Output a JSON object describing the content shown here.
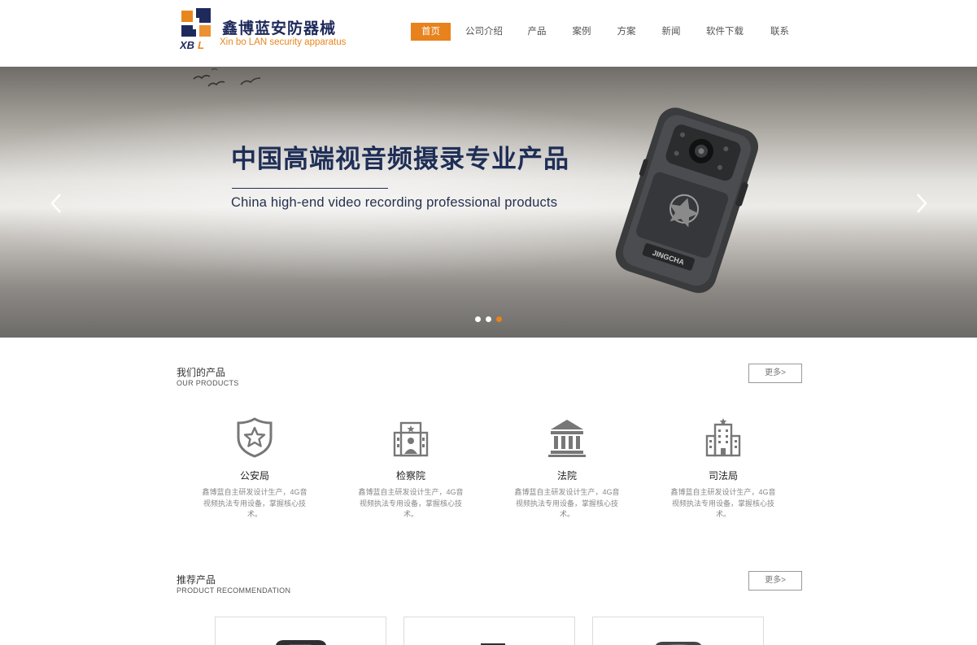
{
  "brand": {
    "name_cn": "鑫博蓝安防器械",
    "name_en": "Xin bo LAN security apparatus",
    "mark": "XBL"
  },
  "nav": {
    "items": [
      {
        "label": "首页",
        "active": true
      },
      {
        "label": "公司介绍",
        "active": false
      },
      {
        "label": "产品",
        "active": false
      },
      {
        "label": "案例",
        "active": false
      },
      {
        "label": "方案",
        "active": false
      },
      {
        "label": "新闻",
        "active": false
      },
      {
        "label": "软件下载",
        "active": false
      },
      {
        "label": "联系",
        "active": false
      }
    ]
  },
  "banner": {
    "title": "中国高端视音频摄录专业产品",
    "subtitle": "China high-end video recording professional products",
    "camera_label": "JINGCHA",
    "prev_icon": "chevron-left-icon",
    "next_icon": "chevron-right-icon",
    "slides_total": 3,
    "active_slide": 3
  },
  "products_section": {
    "title": "我们的产品",
    "subtitle": "OUR PRODUCTS",
    "more": "更多>",
    "items": [
      {
        "name": "公安局",
        "icon": "police-shield-icon",
        "desc": "鑫博蓝自主研发设计生产，4G音视频执法专用设备，掌握核心技术。"
      },
      {
        "name": "检察院",
        "icon": "procuratorate-building-icon",
        "desc": "鑫博蓝自主研发设计生产，4G音视频执法专用设备，掌握核心技术。"
      },
      {
        "name": "法院",
        "icon": "courthouse-icon",
        "desc": "鑫博蓝自主研发设计生产，4G音视频执法专用设备，掌握核心技术。"
      },
      {
        "name": "司法局",
        "icon": "justice-bureau-building-icon",
        "desc": "鑫博蓝自主研发设计生产，4G音视频执法专用设备，掌握核心技术。"
      }
    ]
  },
  "recommend_section": {
    "title": "推荐产品",
    "subtitle": "PRODUCT RECOMMENDATION",
    "more": "更多>"
  },
  "colors": {
    "accent": "#e8821c",
    "brand_navy": "#1f2a5c"
  }
}
